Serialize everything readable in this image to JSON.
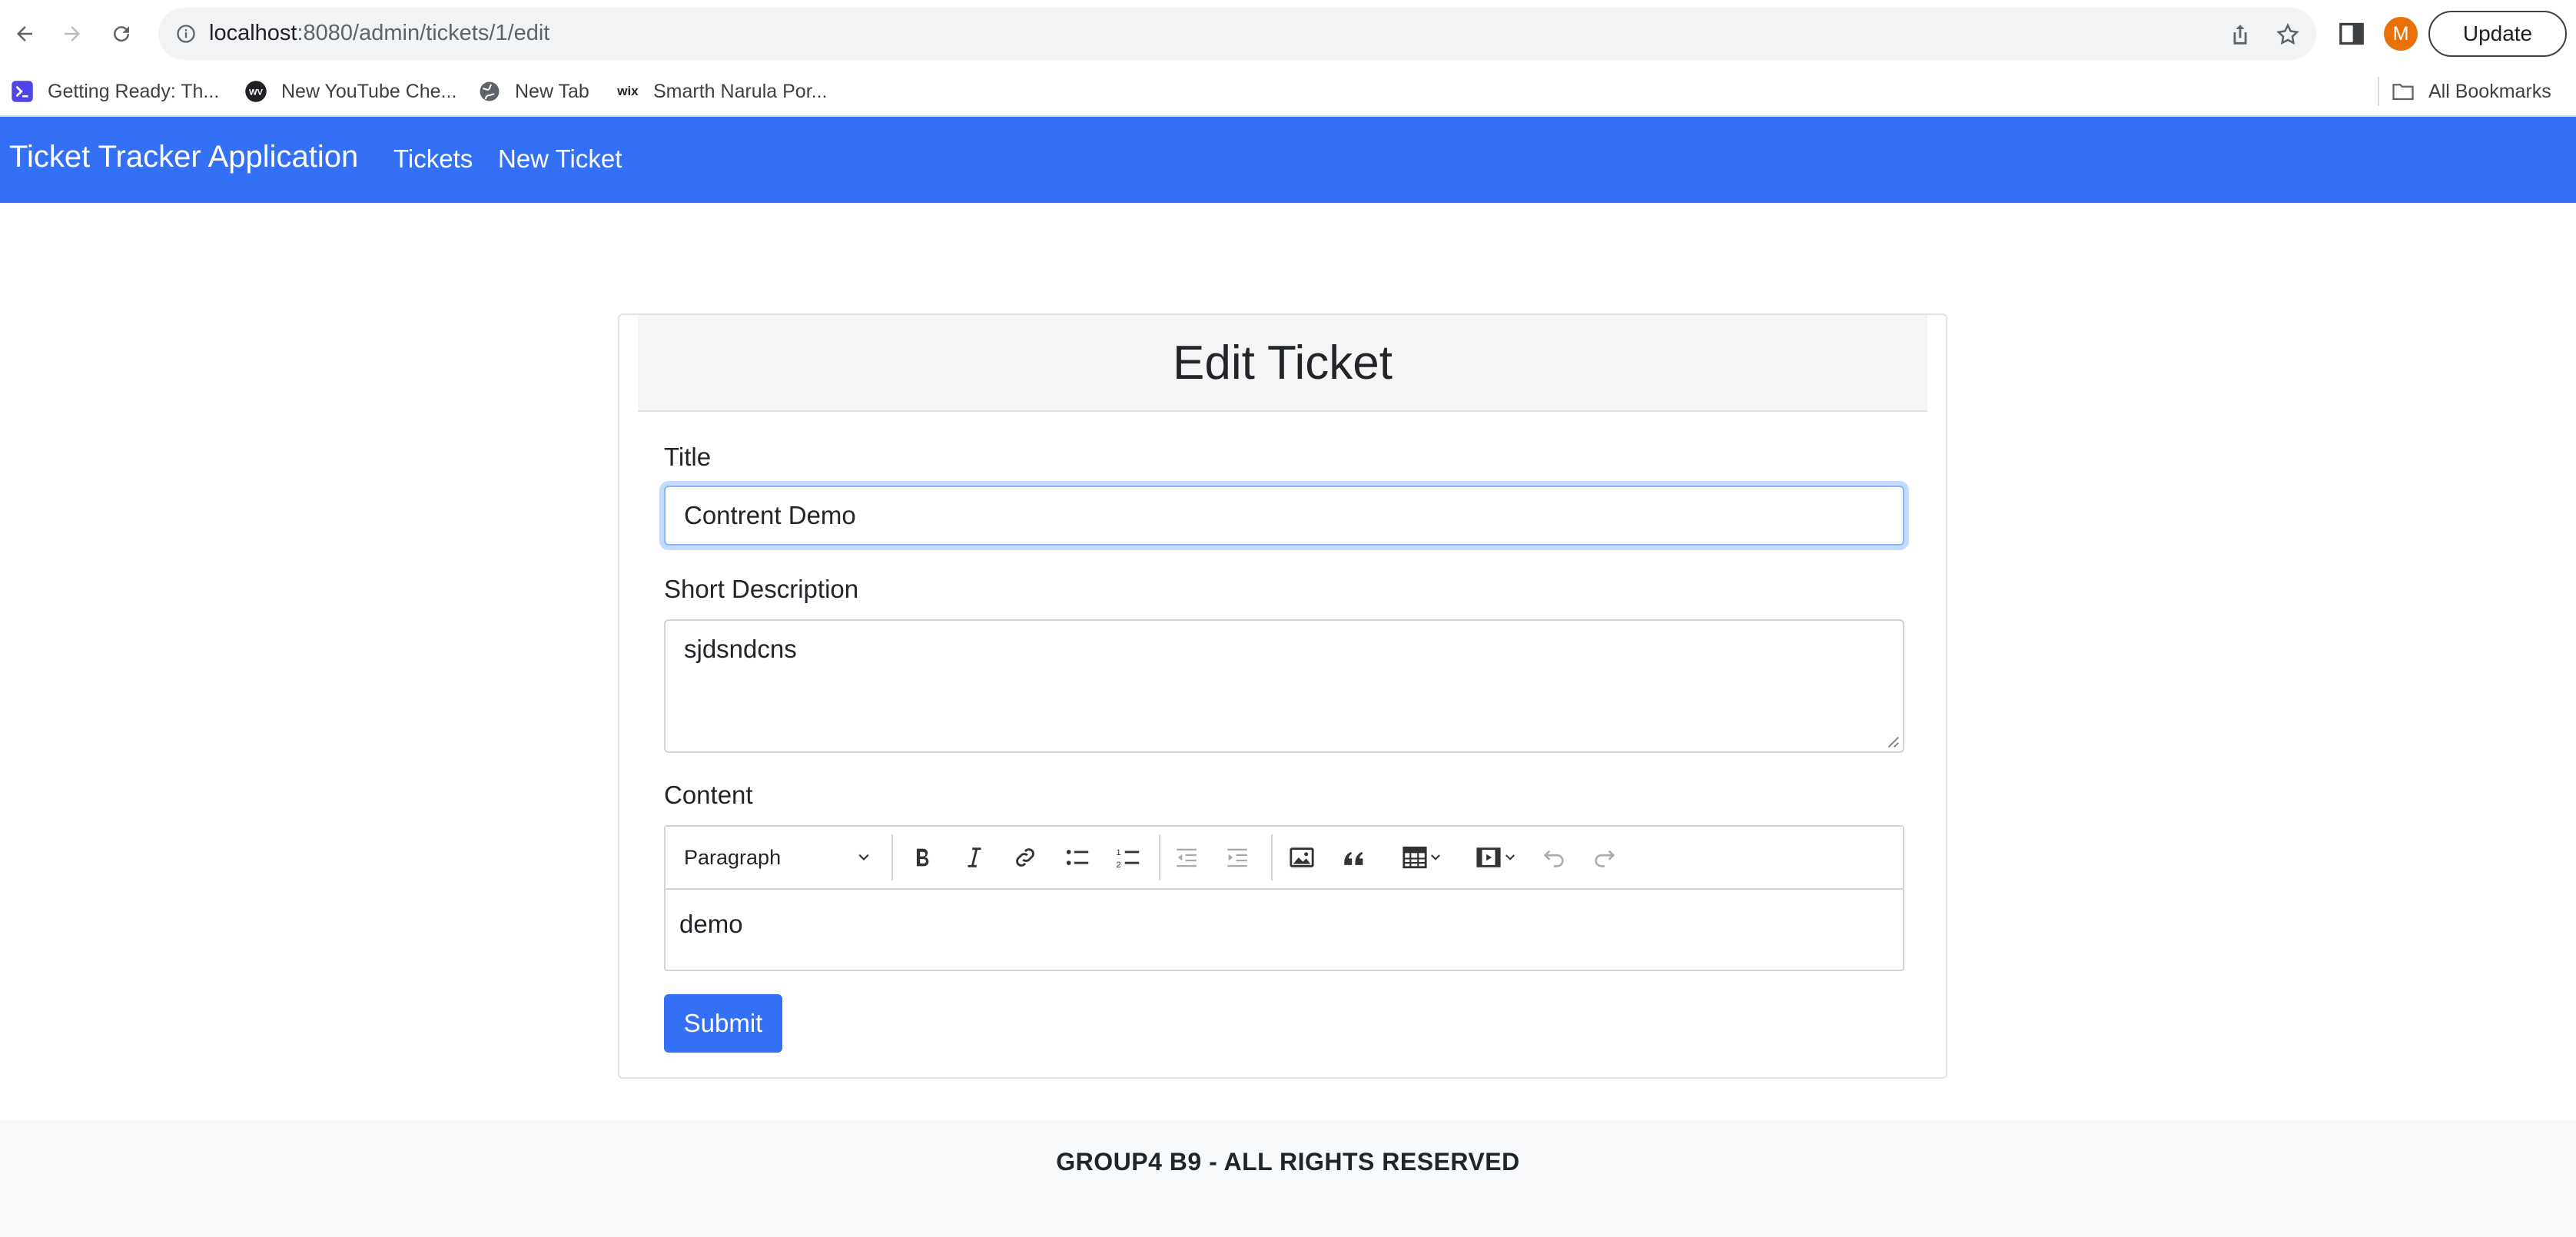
{
  "browser": {
    "url_host": "localhost",
    "url_path": ":8080/admin/tickets/1/edit",
    "avatar_letter": "M",
    "update_label": "Update",
    "bookmarks": [
      {
        "label": "Getting Ready: Th...",
        "icon": "terminal-icon"
      },
      {
        "label": "New YouTube Che...",
        "icon": "wv-icon"
      },
      {
        "label": "New Tab",
        "icon": "globe-icon"
      },
      {
        "label": "Smarth Narula Por...",
        "icon": "wix-icon"
      }
    ],
    "all_bookmarks_label": "All Bookmarks"
  },
  "navbar": {
    "brand": "Ticket Tracker Application",
    "links": [
      "Tickets",
      "New Ticket"
    ],
    "color": "#3370f5"
  },
  "form": {
    "heading": "Edit Ticket",
    "title_label": "Title",
    "title_value": "Contrent Demo",
    "description_label": "Short Description",
    "description_value": "sjdsndcns",
    "content_label": "Content",
    "editor": {
      "heading_select": "Paragraph",
      "toolbar_icons": [
        "bold-icon",
        "italic-icon",
        "link-icon",
        "bulleted-list-icon",
        "numbered-list-icon",
        "outdent-icon",
        "indent-icon",
        "image-icon",
        "blockquote-icon",
        "table-icon",
        "media-icon",
        "undo-icon",
        "redo-icon"
      ],
      "content": "demo"
    },
    "submit_label": "Submit"
  },
  "footer": {
    "text": "GROUP4 B9 - ALL RIGHTS RESERVED"
  }
}
